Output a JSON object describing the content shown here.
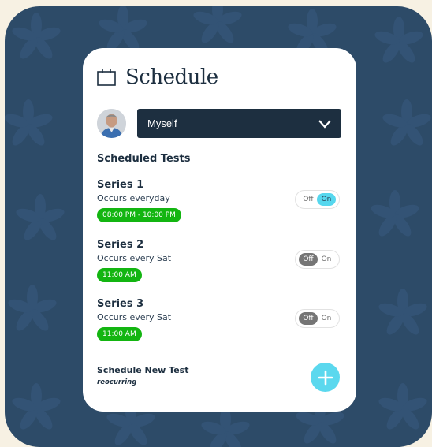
{
  "header": {
    "title": "Schedule",
    "icon": "calendar-icon"
  },
  "person_select": {
    "value": "Myself",
    "icon": "chevron-down-icon"
  },
  "scheduled": {
    "title": "Scheduled Tests",
    "tests": [
      {
        "name": "Series 1",
        "recurrence": "Occurs everyday",
        "time": "08:00 PM - 10:00 PM",
        "off_label": "Off",
        "on_label": "On",
        "enabled": true
      },
      {
        "name": "Series 2",
        "recurrence": "Occurs every Sat",
        "time": "11:00 AM",
        "off_label": "Off",
        "on_label": "On",
        "enabled": false
      },
      {
        "name": "Series 3",
        "recurrence": "Occurs every Sat",
        "time": "11:00 AM",
        "off_label": "Off",
        "on_label": "On",
        "enabled": false
      }
    ]
  },
  "new_test": {
    "label": "Schedule New Test",
    "sub": "reocurring",
    "icon": "plus-icon"
  },
  "colors": {
    "navy": "#1d2f40",
    "green": "#13b511",
    "cyan": "#5bd8ee",
    "backdrop": "#2d4b68"
  }
}
